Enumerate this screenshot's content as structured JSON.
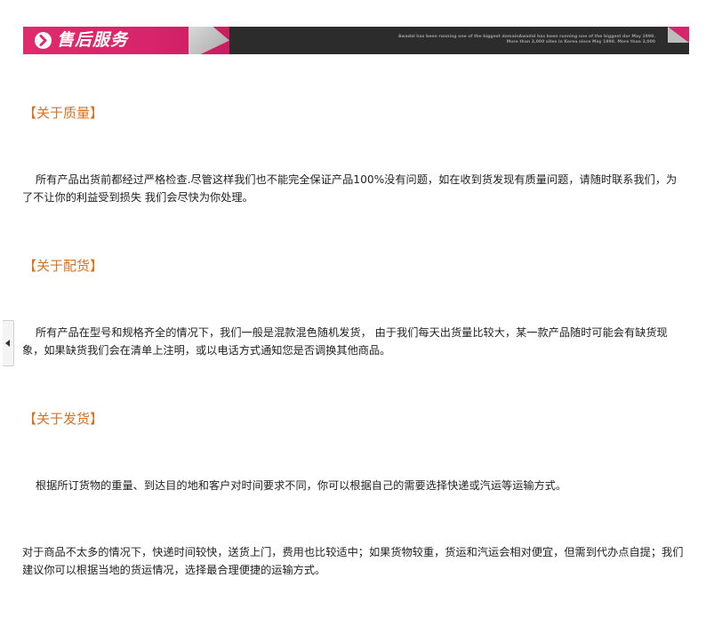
{
  "banner": {
    "title": "售后服务",
    "description": "Awadal has been running one of the biggest domainAwadal has been running one of the biggest dor May 1998. More than 3,000 sites in Korea since May 1998. More than 3,000",
    "colors": {
      "accent": "#e02a6c",
      "bar": "#2c2c2c"
    },
    "icon": "arrow-right-circle-icon"
  },
  "side_tab": {
    "icon": "collapse-left-icon"
  },
  "sections": [
    {
      "heading": "【关于质量】",
      "paragraph": "所有产品出货前都经过严格检查.尽管这样我们也不能完全保证产品100%没有问题，如在收到货发现有质量问题，请随时联系我们，为了不让你的利益受到损失 我们会尽快为你处理。"
    },
    {
      "heading": "【关于配货】",
      "paragraph": "所有产品在型号和规格齐全的情况下，我们一般是混款混色随机发货， 由于我们每天出货量比较大，某一款产品随时可能会有缺货现象，如果缺货我们会在清单上注明，或以电话方式通知您是否调换其他商品。"
    },
    {
      "heading": "【关于发货】",
      "paragraph": "根据所订货物的重量、到达目的地和客户对时间要求不同，你可以根据自己的需要选择快递或汽运等运输方式。",
      "paragraph2": "对于商品不太多的情况下，快递时间较快，送货上门，费用也比较适中；如果货物较重，货运和汽运会相对便宜，但需到代办点自提；我们建议你可以根据当地的货运情况，选择最合理便捷的运输方式。"
    }
  ],
  "colors": {
    "heading": "#d9711f",
    "text": "#222222"
  }
}
